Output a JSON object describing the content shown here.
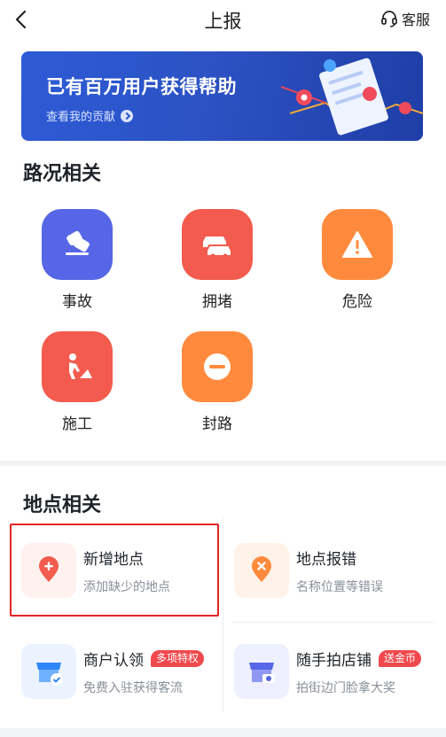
{
  "header": {
    "title": "上报",
    "service_label": "客服"
  },
  "banner": {
    "title": "已有百万用户获得帮助",
    "link_label": "查看我的贡献"
  },
  "road": {
    "section_title": "路况相关",
    "items": [
      {
        "label": "事故",
        "icon": "accident-icon",
        "color": "#5666e6"
      },
      {
        "label": "拥堵",
        "icon": "congestion-car-icon",
        "color": "#f25b4d"
      },
      {
        "label": "危险",
        "icon": "warning-icon",
        "color": "#ff8a3d"
      },
      {
        "label": "施工",
        "icon": "construction-worker-icon",
        "color": "#f25b4d"
      },
      {
        "label": "封路",
        "icon": "road-closed-icon",
        "color": "#ff8a3d"
      }
    ]
  },
  "place": {
    "section_title": "地点相关",
    "items": [
      {
        "name": "新增地点",
        "sub": "添加缺少的地点",
        "icon": "add-location-icon"
      },
      {
        "name": "地点报错",
        "sub": "名称位置等错误",
        "icon": "location-error-icon"
      },
      {
        "name": "商户认领",
        "sub": "免费入驻获得客流",
        "tag": "多项特权",
        "icon": "shop-verify-icon"
      },
      {
        "name": "随手拍店铺",
        "sub": "拍街边门脸拿大奖",
        "tag": "送金币",
        "icon": "shop-camera-icon"
      }
    ]
  },
  "colors": {
    "red": "#f25b4d",
    "orange": "#ff8a3d",
    "blue": "#2c52c4",
    "tag": "#f0494d"
  }
}
